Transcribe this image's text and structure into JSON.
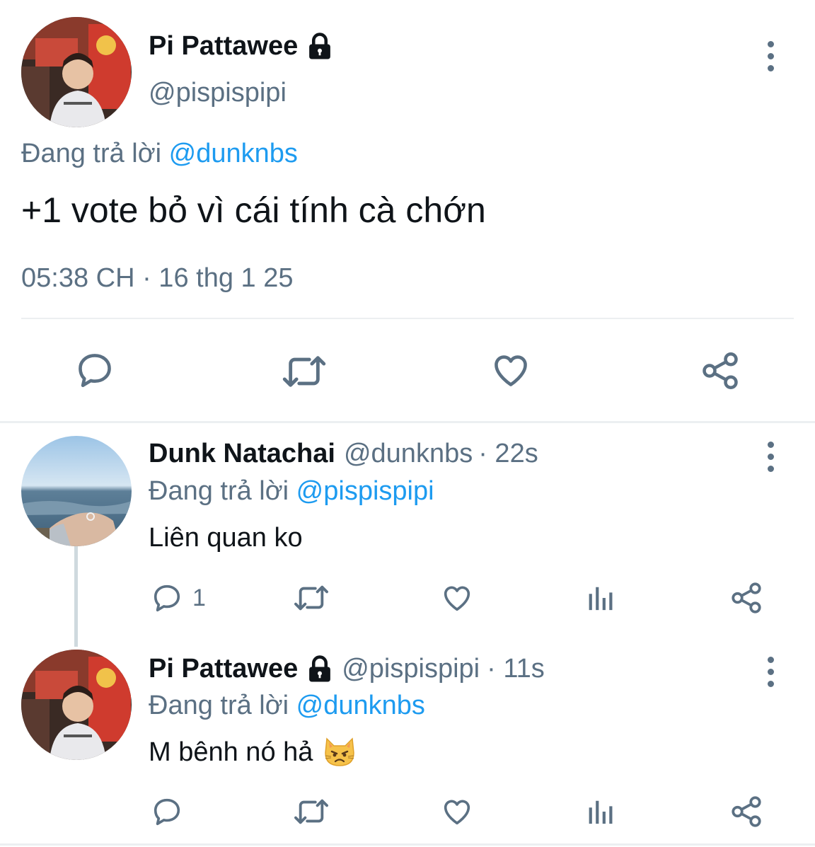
{
  "main_tweet": {
    "author_name": "Pi Pattawee",
    "author_handle": "@pispispipi",
    "reply_label": "Đang trả lời",
    "reply_to": "@dunknbs",
    "text": "+1 vote bỏ vì cái tính cà chớn",
    "timestamp": "05:38 CH · 16 thg 1 25",
    "actions": [
      "reply-icon",
      "retweet-icon",
      "like-icon",
      "share-icon"
    ]
  },
  "replies": [
    {
      "author_name": "Dunk Natachai",
      "author_handle": "@dunknbs",
      "time": "· 22s",
      "reply_label": "Đang trả lời",
      "reply_to": "@pispispipi",
      "text": "Liên quan ko",
      "reply_count": "1"
    },
    {
      "author_name": "Pi Pattawee",
      "author_handle": "@pispispipi",
      "time": "· 11s",
      "reply_label": "Đang trả lời",
      "reply_to": "@dunknbs",
      "text": "M bênh nó hả",
      "emoji": "😾"
    }
  ],
  "colors": {
    "link": "#1d9bf0",
    "muted": "#5b7083",
    "text": "#0f1419",
    "divider": "#eceff1"
  }
}
